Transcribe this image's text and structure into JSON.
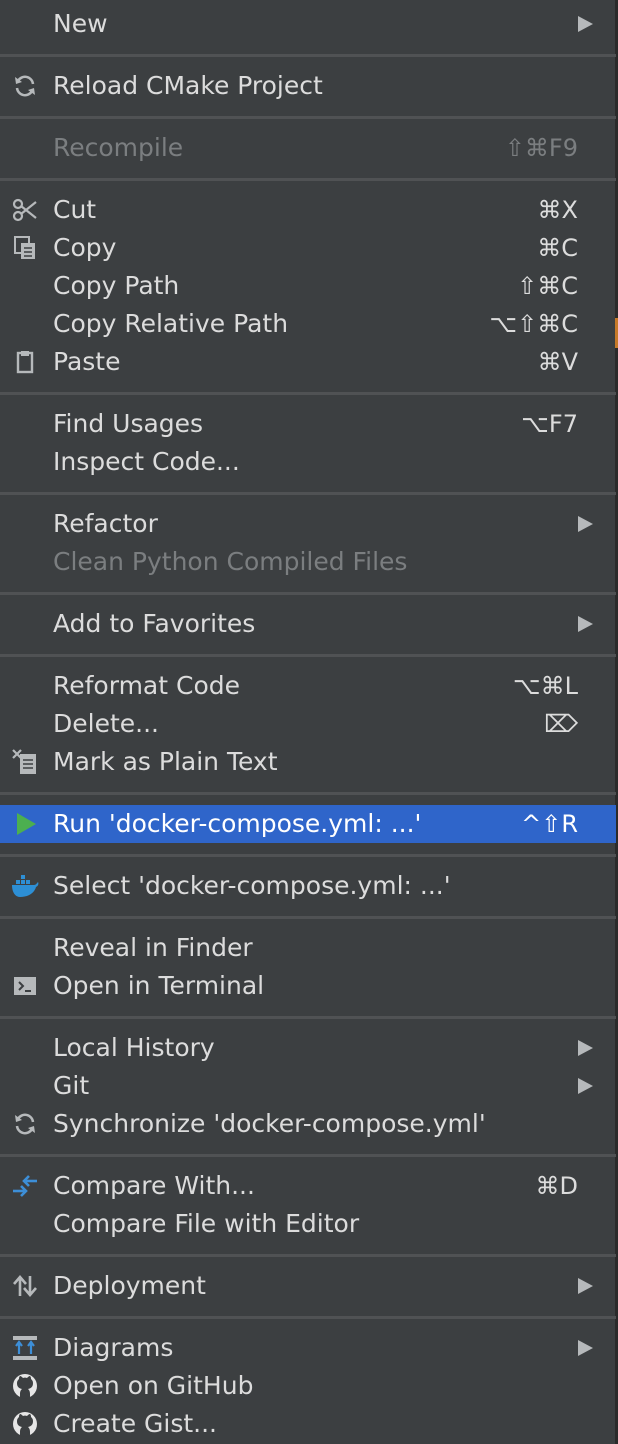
{
  "menu": {
    "items": [
      {
        "label": "New",
        "shortcut": "",
        "submenu": true,
        "icon": "",
        "disabled": false,
        "selected": false
      },
      {
        "label": "Reload CMake Project",
        "shortcut": "",
        "submenu": false,
        "icon": "reload-icon",
        "disabled": false,
        "selected": false
      },
      {
        "label": "Recompile",
        "shortcut": "⇧⌘F9",
        "submenu": false,
        "icon": "",
        "disabled": true,
        "selected": false
      },
      {
        "label": "Cut",
        "shortcut": "⌘X",
        "submenu": false,
        "icon": "scissors-icon",
        "disabled": false,
        "selected": false
      },
      {
        "label": "Copy",
        "shortcut": "⌘C",
        "submenu": false,
        "icon": "copy-icon",
        "disabled": false,
        "selected": false
      },
      {
        "label": "Copy Path",
        "shortcut": "⇧⌘C",
        "submenu": false,
        "icon": "",
        "disabled": false,
        "selected": false
      },
      {
        "label": "Copy Relative Path",
        "shortcut": "⌥⇧⌘C",
        "submenu": false,
        "icon": "",
        "disabled": false,
        "selected": false
      },
      {
        "label": "Paste",
        "shortcut": "⌘V",
        "submenu": false,
        "icon": "clipboard-icon",
        "disabled": false,
        "selected": false
      },
      {
        "label": "Find Usages",
        "shortcut": "⌥F7",
        "submenu": false,
        "icon": "",
        "disabled": false,
        "selected": false
      },
      {
        "label": "Inspect Code...",
        "shortcut": "",
        "submenu": false,
        "icon": "",
        "disabled": false,
        "selected": false
      },
      {
        "label": "Refactor",
        "shortcut": "",
        "submenu": true,
        "icon": "",
        "disabled": false,
        "selected": false
      },
      {
        "label": "Clean Python Compiled Files",
        "shortcut": "",
        "submenu": false,
        "icon": "",
        "disabled": true,
        "selected": false
      },
      {
        "label": "Add to Favorites",
        "shortcut": "",
        "submenu": true,
        "icon": "",
        "disabled": false,
        "selected": false
      },
      {
        "label": "Reformat Code",
        "shortcut": "⌥⌘L",
        "submenu": false,
        "icon": "",
        "disabled": false,
        "selected": false
      },
      {
        "label": "Delete...",
        "shortcut": "⌦",
        "submenu": false,
        "icon": "",
        "disabled": false,
        "selected": false
      },
      {
        "label": "Mark as Plain Text",
        "shortcut": "",
        "submenu": false,
        "icon": "plain-text-icon",
        "disabled": false,
        "selected": false
      },
      {
        "label": "Run 'docker-compose.yml: ...'",
        "shortcut": "^⇧R",
        "submenu": false,
        "icon": "run-icon",
        "disabled": false,
        "selected": true
      },
      {
        "label": "Select 'docker-compose.yml: ...'",
        "shortcut": "",
        "submenu": false,
        "icon": "docker-icon",
        "disabled": false,
        "selected": false
      },
      {
        "label": "Reveal in Finder",
        "shortcut": "",
        "submenu": false,
        "icon": "",
        "disabled": false,
        "selected": false
      },
      {
        "label": "Open in Terminal",
        "shortcut": "",
        "submenu": false,
        "icon": "terminal-icon",
        "disabled": false,
        "selected": false
      },
      {
        "label": "Local History",
        "shortcut": "",
        "submenu": true,
        "icon": "",
        "disabled": false,
        "selected": false
      },
      {
        "label": "Git",
        "shortcut": "",
        "submenu": true,
        "icon": "",
        "disabled": false,
        "selected": false
      },
      {
        "label": "Synchronize 'docker-compose.yml'",
        "shortcut": "",
        "submenu": false,
        "icon": "reload-icon",
        "disabled": false,
        "selected": false
      },
      {
        "label": "Compare With...",
        "shortcut": "⌘D",
        "submenu": false,
        "icon": "compare-icon",
        "disabled": false,
        "selected": false
      },
      {
        "label": "Compare File with Editor",
        "shortcut": "",
        "submenu": false,
        "icon": "",
        "disabled": false,
        "selected": false
      },
      {
        "label": "Deployment",
        "shortcut": "",
        "submenu": true,
        "icon": "deployment-icon",
        "disabled": false,
        "selected": false
      },
      {
        "label": "Diagrams",
        "shortcut": "",
        "submenu": true,
        "icon": "diagram-icon",
        "disabled": false,
        "selected": false
      },
      {
        "label": "Open on GitHub",
        "shortcut": "",
        "submenu": false,
        "icon": "github-icon",
        "disabled": false,
        "selected": false
      },
      {
        "label": "Create Gist...",
        "shortcut": "",
        "submenu": false,
        "icon": "github-icon",
        "disabled": false,
        "selected": false
      }
    ]
  },
  "colors": {
    "background": "#3c3f41",
    "selection": "#2f65ca",
    "separator": "#505254",
    "text": "#dcdcdc",
    "disabled_text": "#7b7e80",
    "run_icon": "#4caf50",
    "docker_icon": "#2d8fd5"
  }
}
